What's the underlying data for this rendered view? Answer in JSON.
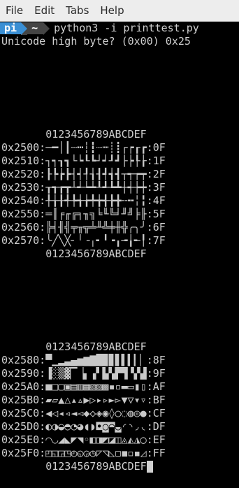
{
  "menubar": {
    "items": [
      "File",
      "Edit",
      "Tabs",
      "Help"
    ]
  },
  "terminal": {
    "prompt_user": "pi",
    "prompt_dir": "~",
    "command": "python3 -i printtest.py",
    "output_line": "Unicode high byte? (0x00) 0x25",
    "header": "       0123456789ABCDEF",
    "block1": [
      {
        "prefix": "0x2500:",
        "glyphs": "─━│┃┄┅┆┇┈┉┊┋┌┍┎┏",
        "suffix": ":0F"
      },
      {
        "prefix": "0x2510:",
        "glyphs": "┐┑┒┓└┕┖┗┘┙┚┛├┝┞┟",
        "suffix": ":1F"
      },
      {
        "prefix": "0x2520:",
        "glyphs": "┠┡┢┣┤┥┦┧┨┩┪┫┬┭┮┯",
        "suffix": ":2F"
      },
      {
        "prefix": "0x2530:",
        "glyphs": "┰┱┲┳┴┵┶┷┸┹┺┻┼┽┾┿",
        "suffix": ":3F"
      },
      {
        "prefix": "0x2540:",
        "glyphs": "╀╁╂╃╄╅╆╇╈╉╊╋╌╍╎╏",
        "suffix": ":4F"
      },
      {
        "prefix": "0x2550:",
        "glyphs": "═║╒╓╔╕╖╗╘╙╚╛╜╝╞╟",
        "suffix": ":5F"
      },
      {
        "prefix": "0x2560:",
        "glyphs": "╠╡╢╣╤╥╦╧╨╩╪╫╬╭╮╯",
        "suffix": ":6F"
      },
      {
        "prefix": "0x2570:",
        "glyphs": "╰╱╲╳╴╵╶╷╸╹╺╻╼╽╾╿",
        "suffix": ":7F"
      }
    ],
    "block2": [
      {
        "prefix": "0x2580:",
        "glyphs": "▀▁▂▃▄▅▆▇█▉▊▋▌▍▎▏",
        "suffix": ":8F"
      },
      {
        "prefix": "0x2590:",
        "glyphs": "▐░▒▓▔▕▖▗▘▙▚▛▜▝▞▟",
        "suffix": ":9F"
      },
      {
        "prefix": "0x25A0:",
        "glyphs": "■□▢▣▤▥▦▧▨▩▪▫▬▭▮▯",
        "suffix": ":AF"
      },
      {
        "prefix": "0x25B0:",
        "glyphs": "▰▱▲△▴▵▶▷▸▹►▻▼▽▾▿",
        "suffix": ":BF"
      },
      {
        "prefix": "0x25C0:",
        "glyphs": "◀◁◂◃◄◅◆◇◈◉◊○◌◍◎●",
        "suffix": ":CF"
      },
      {
        "prefix": "0x25D0:",
        "glyphs": "◐◑◒◓◔◕◖◗◘◙◚◛◜◝◞◟",
        "suffix": ":DF"
      },
      {
        "prefix": "0x25E0:",
        "glyphs": "◠◡◢◣◤◥◦◧◨◩◪◫◬◭◮◯",
        "suffix": ":EF"
      },
      {
        "prefix": "0x25F0:",
        "glyphs": "◰◱◲◳◴◵◶◷◸◹◺◻◼◽◾◿",
        "suffix": ":FF"
      }
    ]
  }
}
